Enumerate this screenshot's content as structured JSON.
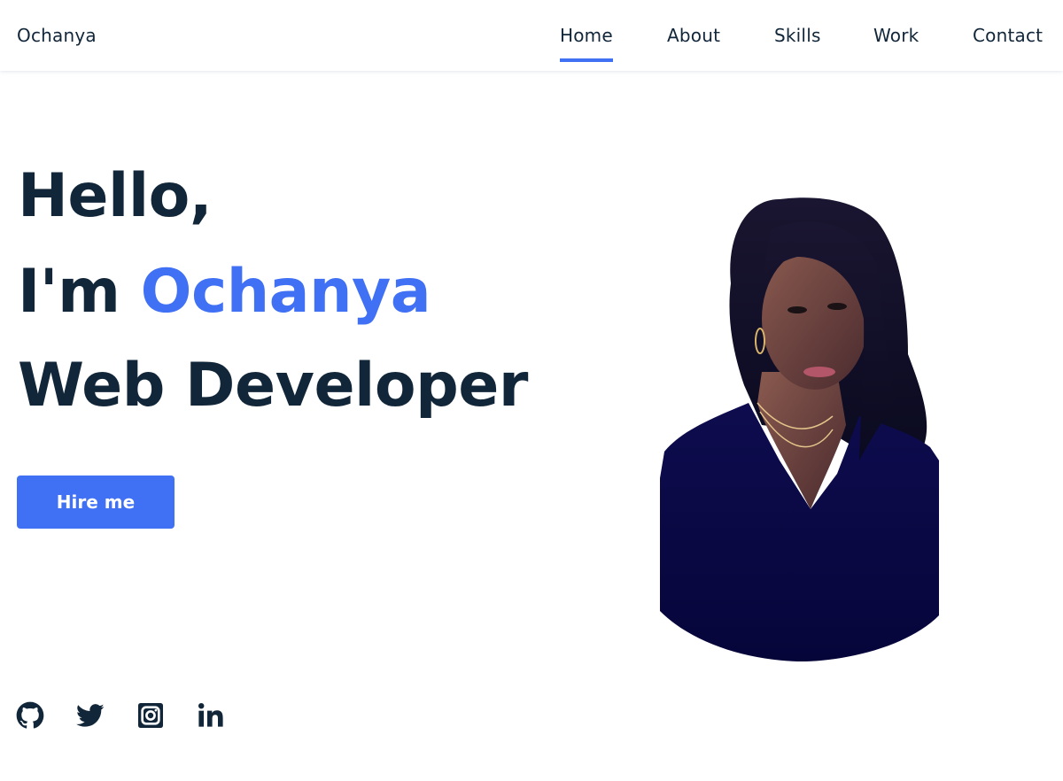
{
  "header": {
    "logo": "Ochanya",
    "nav": [
      {
        "label": "Home",
        "active": true
      },
      {
        "label": "About",
        "active": false
      },
      {
        "label": "Skills",
        "active": false
      },
      {
        "label": "Work",
        "active": false
      },
      {
        "label": "Contact",
        "active": false
      }
    ]
  },
  "hero": {
    "greeting": "Hello,",
    "intro_prefix": "I'm",
    "name": "Ochanya",
    "role": "Web Developer",
    "cta_label": "Hire me"
  },
  "social": [
    {
      "icon": "github-icon"
    },
    {
      "icon": "twitter-icon"
    },
    {
      "icon": "instagram-icon"
    },
    {
      "icon": "linkedin-icon"
    }
  ],
  "portrait": {
    "alt": "portrait-photo"
  },
  "colors": {
    "accent": "#4070f4",
    "text": "#12263a",
    "background": "#ffffff",
    "shirt": "#0b0a44"
  }
}
